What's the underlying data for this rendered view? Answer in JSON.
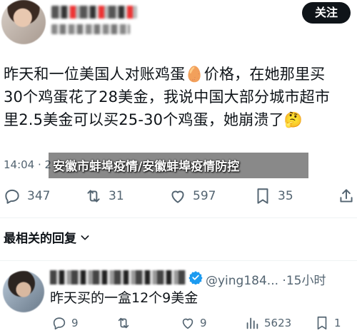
{
  "header": {
    "follow_label": "关注"
  },
  "post": {
    "text": "昨天和一位美国人对账鸡蛋🥚价格，在她那里买\n30个鸡蛋花了28美金，我说中国大部分城市超市\n里2.5美金可以买25-30个鸡蛋，她崩溃了🤔",
    "time_prefix": "14:04 · 2"
  },
  "overlay": {
    "caption": "安徽市蚌埠疫情/安徽蚌埠疫情防控"
  },
  "actions": {
    "reply_count": "347",
    "retweet_count": "31",
    "like_count": "597",
    "bookmark_count": "35"
  },
  "replies_section": {
    "title": "最相关的回复"
  },
  "reply": {
    "handle_time": "@ying184... ·15小时",
    "text": "昨天买的一盒12个9美金",
    "reply_count": "9",
    "like_count": "9",
    "views_count": "5623",
    "bookmark_count": "1"
  },
  "colors": {
    "text_primary": "#0f1419",
    "text_secondary": "#536471",
    "verified": "#1d9bf0"
  }
}
